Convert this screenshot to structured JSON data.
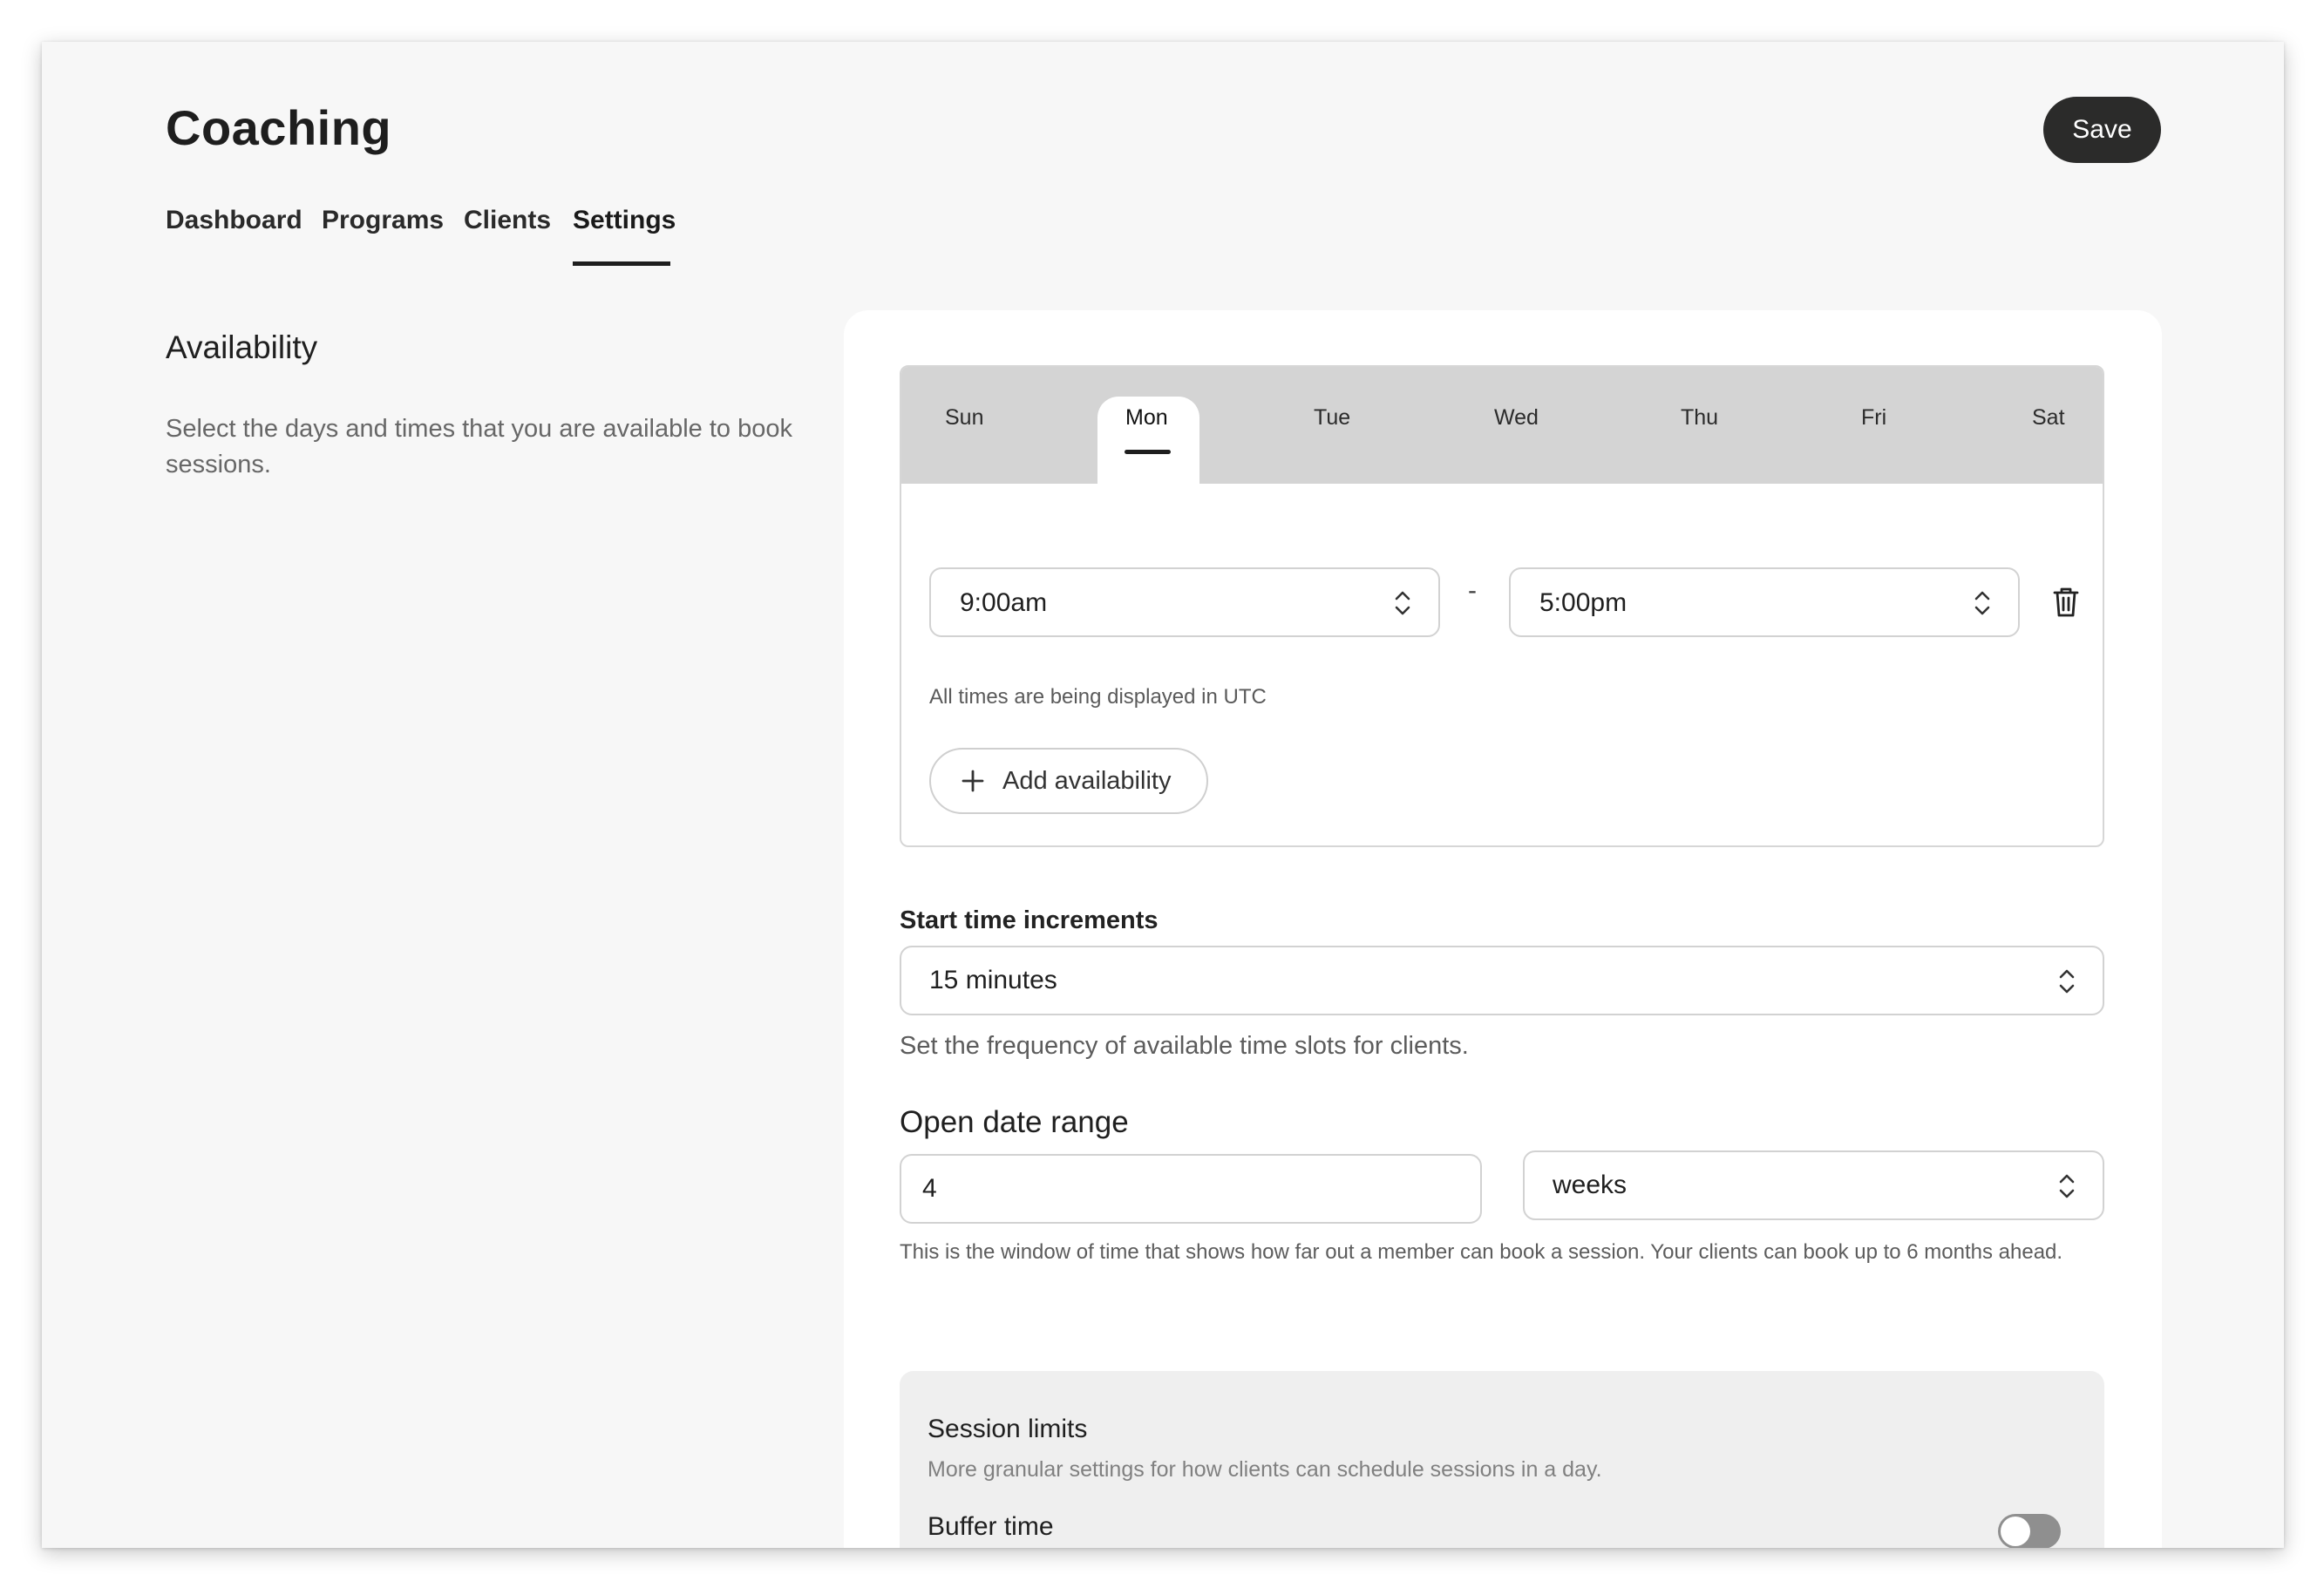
{
  "app": {
    "title": "Coaching"
  },
  "header": {
    "save_label": "Save"
  },
  "nav": {
    "tabs": [
      {
        "label": "Dashboard"
      },
      {
        "label": "Programs"
      },
      {
        "label": "Clients"
      },
      {
        "label": "Settings",
        "active": true
      }
    ]
  },
  "availability": {
    "title": "Availability",
    "description": "Select the days and times that you are available to book sessions."
  },
  "schedule": {
    "days": [
      "Sun",
      "Mon",
      "Tue",
      "Wed",
      "Thu",
      "Fri",
      "Sat"
    ],
    "selected_day": "Mon",
    "slot": {
      "start": "9:00am",
      "separator": "-",
      "end": "5:00pm"
    },
    "timezone_note": "All times are being displayed in UTC",
    "add_label": "Add availability"
  },
  "increments": {
    "label": "Start time increments",
    "value": "15 minutes",
    "help": "Set the frequency of available time slots for clients."
  },
  "date_range": {
    "label": "Open date range",
    "amount": "4",
    "unit": "weeks",
    "help": "This is the window of time that shows how far out a member can book a session. Your clients can book up to 6 months ahead."
  },
  "session_limits": {
    "title": "Session limits",
    "description": "More granular settings for how clients can schedule sessions in a day.",
    "buffer_label": "Buffer time",
    "buffer_enabled": false
  },
  "colors": {
    "primary_button": "#2b2b2a",
    "tab_bar": "#d4d4d4",
    "background": "#f7f7f7",
    "toggle_off": "#8f8f8f"
  }
}
